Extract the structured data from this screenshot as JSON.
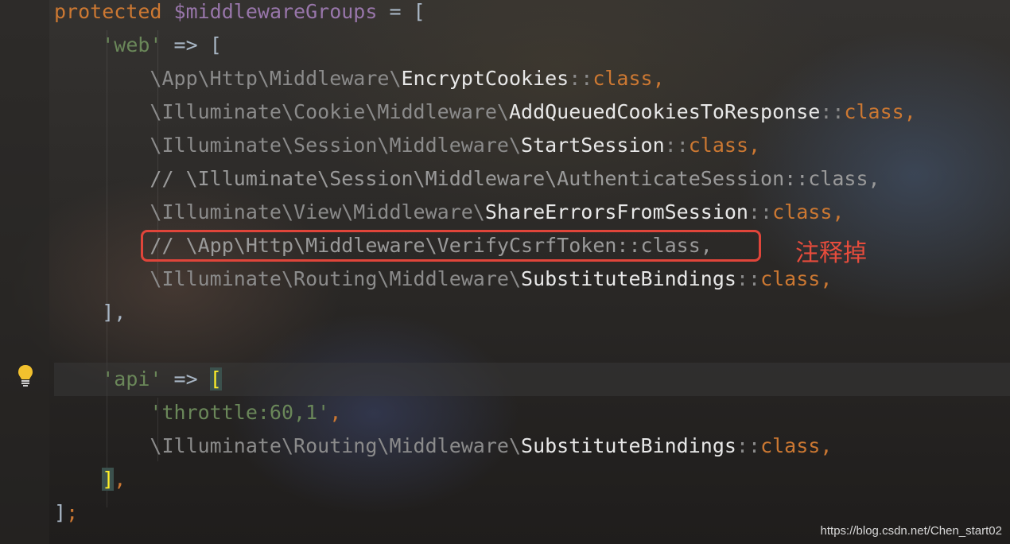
{
  "code": {
    "line1": {
      "kw": "protected",
      "var": "$middlewareGroups",
      "rest": " = ["
    },
    "line2": {
      "str": "'web'",
      "rest": " => ["
    },
    "line3": {
      "ns": "\\App\\Http\\Middleware\\",
      "cls": "EncryptCookies",
      "sep": "::",
      "kw": "class",
      "end": ","
    },
    "line4": {
      "ns": "\\Illuminate\\Cookie\\Middleware\\",
      "cls": "AddQueuedCookiesToResponse",
      "sep": "::",
      "kw": "class",
      "end": ","
    },
    "line5": {
      "ns": "\\Illuminate\\Session\\Middleware\\",
      "cls": "StartSession",
      "sep": "::",
      "kw": "class",
      "end": ","
    },
    "line6": {
      "comment": "// \\Illuminate\\Session\\Middleware\\AuthenticateSession::class,"
    },
    "line7": {
      "ns": "\\Illuminate\\View\\Middleware\\",
      "cls": "ShareErrorsFromSession",
      "sep": "::",
      "kw": "class",
      "end": ","
    },
    "line8": {
      "comment": "// \\App\\Http\\Middleware\\VerifyCsrfToken::class,"
    },
    "line9": {
      "ns": "\\Illuminate\\Routing\\Middleware\\",
      "cls": "SubstituteBindings",
      "sep": "::",
      "kw": "class",
      "end": ","
    },
    "line10": {
      "text": "],"
    },
    "line12": {
      "str": "'api'",
      "arrow": " => ",
      "bracket": "["
    },
    "line13": {
      "str": "'throttle:60,1'",
      "end": ","
    },
    "line14": {
      "ns": "\\Illuminate\\Routing\\Middleware\\",
      "cls": "SubstituteBindings",
      "sep": "::",
      "kw": "class",
      "end": ","
    },
    "line15": {
      "bracket": "]",
      "end": ","
    },
    "line16": {
      "text": "]",
      "end": ";"
    }
  },
  "annotation": {
    "text": "注释掉",
    "color": "#e74c3c"
  },
  "watermark": {
    "text": "https://blog.csdn.net/Chen_start02"
  },
  "icons": {
    "gutter": "lightbulb-icon"
  },
  "colors": {
    "keyword": "#cc7832",
    "variable": "#9876aa",
    "string": "#6a8759",
    "highlight_box": "#e0453a"
  }
}
